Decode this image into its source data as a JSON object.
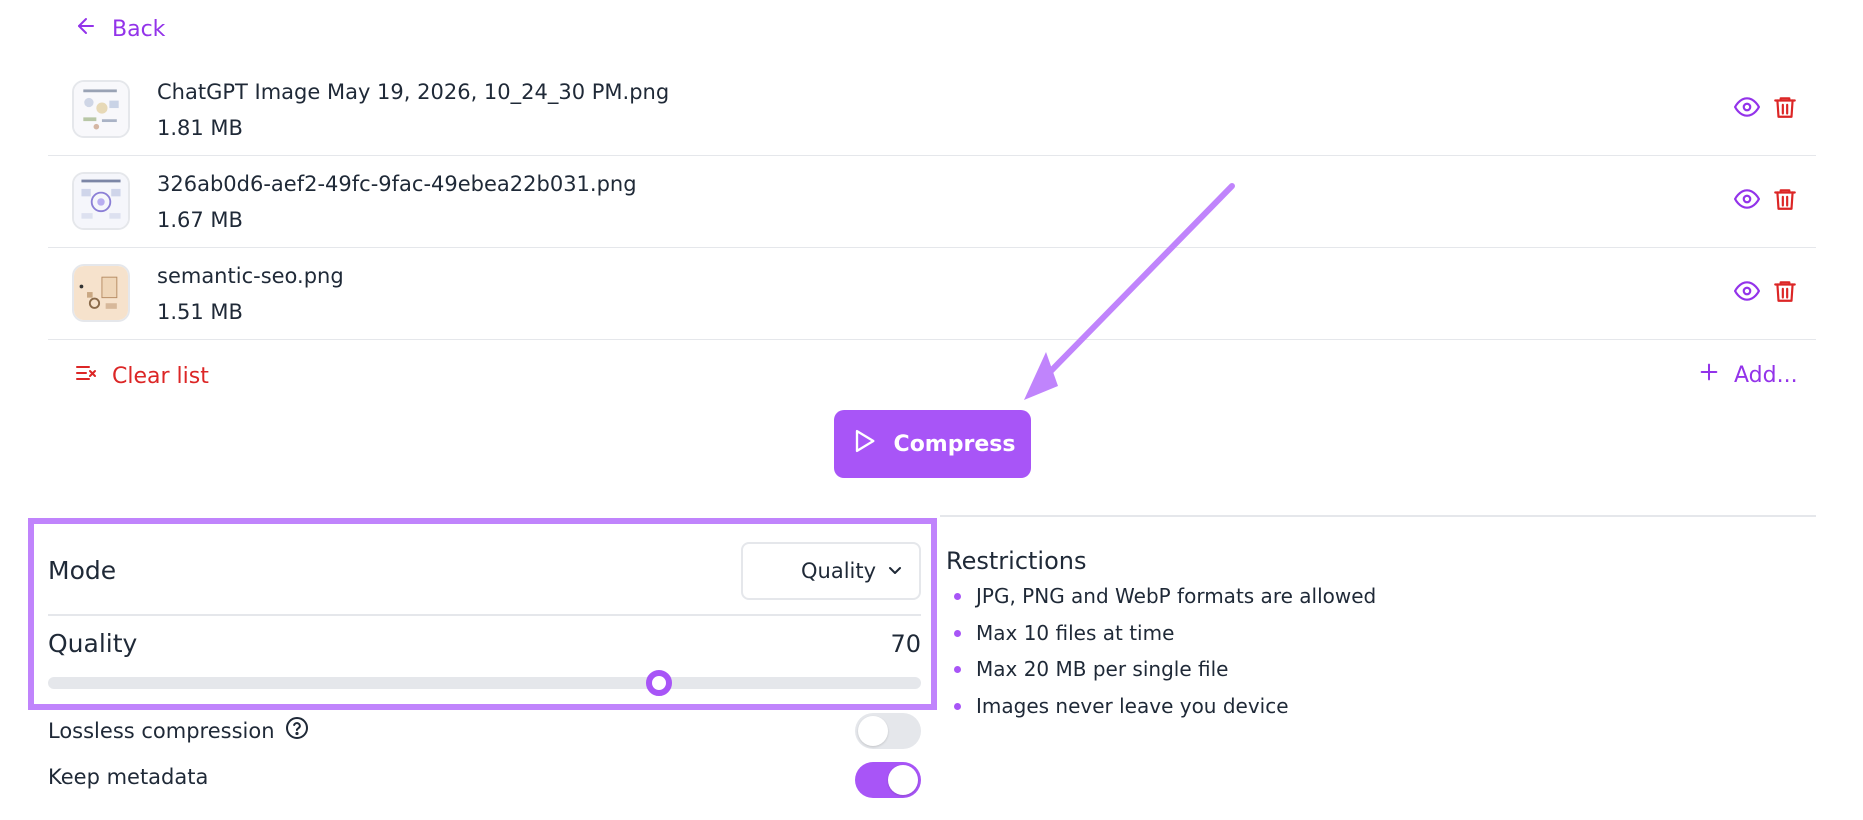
{
  "nav": {
    "back_label": "Back"
  },
  "files": [
    {
      "name": "ChatGPT Image May 19, 2026, 10_24_30 PM.png",
      "size": "1.81 MB"
    },
    {
      "name": "326ab0d6-aef2-49fc-9fac-49ebea22b031.png",
      "size": "1.67 MB"
    },
    {
      "name": "semantic-seo.png",
      "size": "1.51 MB"
    }
  ],
  "list_actions": {
    "clear_label": "Clear list",
    "add_label": "Add..."
  },
  "compress": {
    "label": "Compress"
  },
  "settings": {
    "mode_label": "Mode",
    "mode_value": "Quality",
    "quality_label": "Quality",
    "quality_value": "70",
    "quality_fraction": 0.7,
    "lossless_label": "Lossless compression",
    "lossless_on": false,
    "metadata_label": "Keep metadata",
    "metadata_on": true
  },
  "restrictions": {
    "title": "Restrictions",
    "items": [
      "JPG, PNG and WebP formats are allowed",
      "Max 10 files at time",
      "Max 20 MB per single file",
      "Images never leave you device"
    ]
  },
  "colors": {
    "accent": "#a855f7",
    "accent_text": "#9333ea",
    "danger": "#dc2626",
    "highlight": "#c084fc"
  },
  "icons": [
    "back-arrow-icon",
    "eye-icon",
    "trash-icon",
    "clear-list-icon",
    "plus-icon",
    "play-icon",
    "chevron-down-icon",
    "help-circle-icon"
  ]
}
